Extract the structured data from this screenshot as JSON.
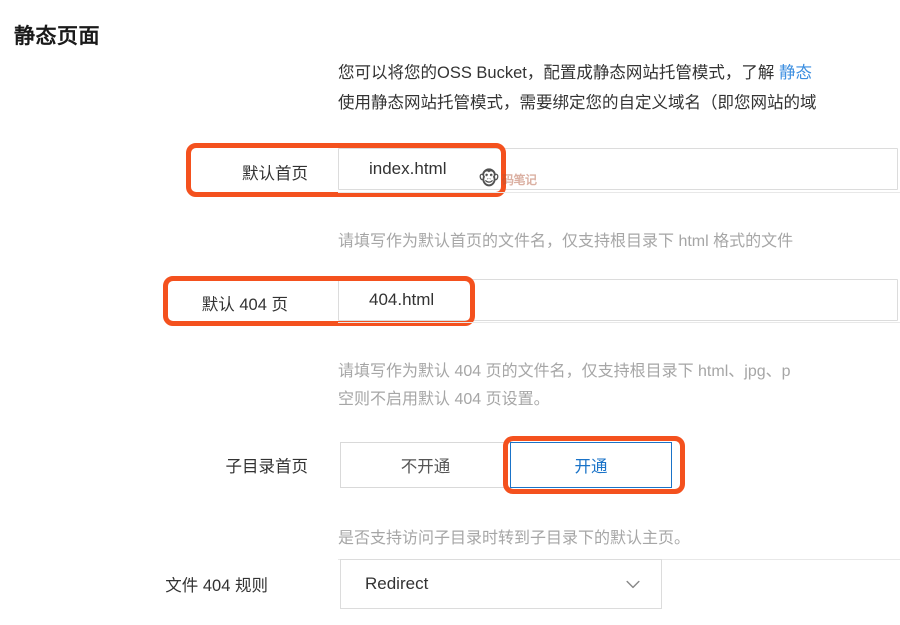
{
  "page": {
    "title": "静态页面"
  },
  "intro": {
    "line1_prefix": "您可以将您的OSS Bucket，配置成静态网站托管模式，了解 ",
    "line1_link": "静态",
    "line2": "使用静态网站托管模式，需要绑定您的自定义域名（即您网站的域"
  },
  "fields": {
    "default_home": {
      "label": "默认首页",
      "value": "index.html",
      "helper": "请填写作为默认首页的文件名，仅支持根目录下 html 格式的文件"
    },
    "default_404": {
      "label": "默认 404 页",
      "value": "404.html",
      "helper_line1": "请填写作为默认 404 页的文件名，仅支持根目录下 html、jpg、p",
      "helper_line2": "空则不启用默认 404 页设置。"
    },
    "subdir_home": {
      "label": "子目录首页",
      "options": [
        {
          "label": "不开通",
          "selected": false
        },
        {
          "label": "开通",
          "selected": true
        }
      ],
      "selected_value": "开通",
      "helper": "是否支持访问子目录时转到子目录下的默认主页。"
    },
    "file_404_rule": {
      "label": "文件 404 规则",
      "value": "Redirect",
      "chevron_icon": "chevron-down-icon"
    }
  },
  "annotations": {
    "highlight_color": "#f4511e",
    "accent_color": "#1a73c8",
    "link_color": "#3b8ee0",
    "helper_color": "#a6a6a6"
  },
  "watermark": {
    "icon": "monkey-face-icon",
    "glyph": "🐵",
    "text": "码笔记"
  }
}
